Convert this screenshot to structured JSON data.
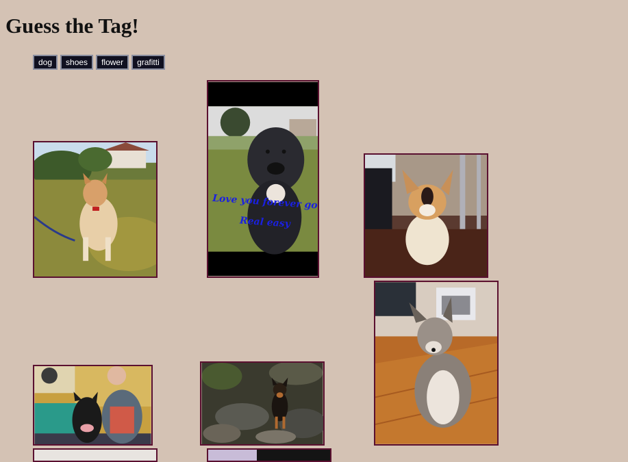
{
  "page": {
    "title": "Guess the Tag!"
  },
  "tags": [
    "dog",
    "shoes",
    "flower",
    "grafitti"
  ],
  "photos": [
    {
      "subject": "shiba-dog-on-lawn"
    },
    {
      "subject": "black-pitbull-on-grass",
      "caption_line1": "Love you forever good boy",
      "caption_line2": "Real easy"
    },
    {
      "subject": "corgi-puppy-on-floor"
    },
    {
      "subject": "shepherd-dog-on-parquet"
    },
    {
      "subject": "man-with-german-shepherd"
    },
    {
      "subject": "small-dog-on-rocks"
    },
    {
      "subject": "partial-photo-bottom-left"
    },
    {
      "subject": "partial-photo-bottom-center"
    }
  ]
}
